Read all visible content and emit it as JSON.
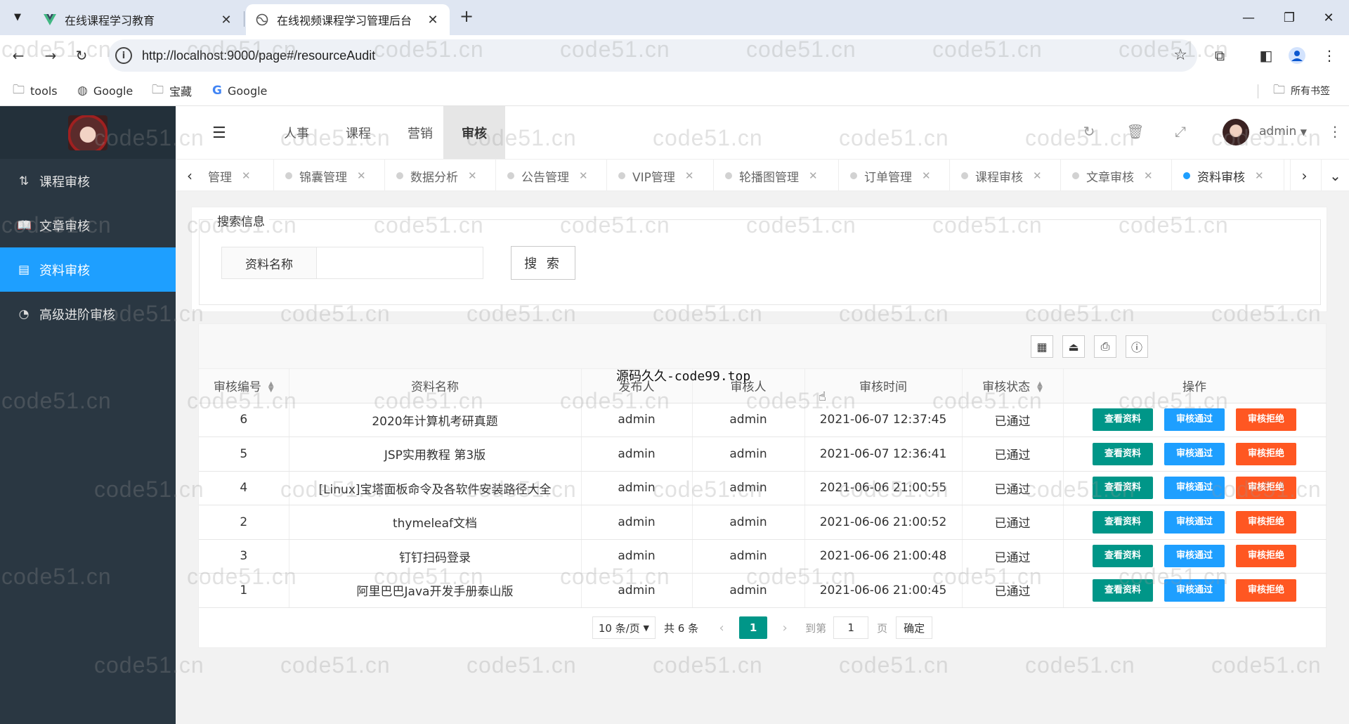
{
  "browser": {
    "tabs": [
      {
        "title": "在线课程学习教育",
        "active": false
      },
      {
        "title": "在线视频课程学习管理后台",
        "active": true
      }
    ],
    "url": "http://localhost:9000/page#/resourceAudit",
    "bookmarks": [
      "tools",
      "Google",
      "宝藏",
      "Google"
    ],
    "all_bookmarks": "所有书签"
  },
  "sidebar": {
    "items": [
      {
        "label": "课程审核",
        "icon": "sort-list-icon",
        "active": false
      },
      {
        "label": "文章审核",
        "icon": "book-icon",
        "active": false
      },
      {
        "label": "资料审核",
        "icon": "document-icon",
        "active": true
      },
      {
        "label": "高级进阶审核",
        "icon": "pie-chart-icon",
        "active": false
      }
    ]
  },
  "header": {
    "nav": [
      "人事",
      "课程",
      "营销",
      "审核"
    ],
    "active_nav": "审核",
    "user": "admin"
  },
  "page_tabs": [
    {
      "label": "管理"
    },
    {
      "label": "锦囊管理"
    },
    {
      "label": "数据分析"
    },
    {
      "label": "公告管理"
    },
    {
      "label": "VIP管理"
    },
    {
      "label": "轮播图管理"
    },
    {
      "label": "订单管理"
    },
    {
      "label": "课程审核"
    },
    {
      "label": "文章审核"
    },
    {
      "label": "资料审核",
      "active": true
    }
  ],
  "search": {
    "legend": "搜索信息",
    "label": "资料名称",
    "value": "",
    "button": "搜 索"
  },
  "overlay_text": "源码久久-code99.top",
  "table": {
    "columns": [
      "审核编号",
      "资料名称",
      "发布人",
      "审核人",
      "审核时间",
      "审核状态",
      "操作"
    ],
    "rows": [
      {
        "id": "6",
        "name": "2020年计算机考研真题",
        "publisher": "admin",
        "auditor": "admin",
        "time": "2021-06-07 12:37:45",
        "status": "已通过"
      },
      {
        "id": "5",
        "name": "JSP实用教程 第3版",
        "publisher": "admin",
        "auditor": "admin",
        "time": "2021-06-07 12:36:41",
        "status": "已通过"
      },
      {
        "id": "4",
        "name": "[Linux]宝塔面板命令及各软件安装路径大全",
        "publisher": "admin",
        "auditor": "admin",
        "time": "2021-06-06 21:00:55",
        "status": "已通过"
      },
      {
        "id": "2",
        "name": "thymeleaf文档",
        "publisher": "admin",
        "auditor": "admin",
        "time": "2021-06-06 21:00:52",
        "status": "已通过"
      },
      {
        "id": "3",
        "name": "钉钉扫码登录",
        "publisher": "admin",
        "auditor": "admin",
        "time": "2021-06-06 21:00:48",
        "status": "已通过"
      },
      {
        "id": "1",
        "name": "阿里巴巴Java开发手册泰山版",
        "publisher": "admin",
        "auditor": "admin",
        "time": "2021-06-06 21:00:45",
        "status": "已通过"
      }
    ],
    "actions": [
      "查看资料",
      "审核通过",
      "审核拒绝"
    ]
  },
  "pager": {
    "per_page": "10 条/页",
    "total": "共 6 条",
    "current": "1",
    "goto_label": "到第",
    "goto_value": "1",
    "page_label": "页",
    "confirm": "确定"
  },
  "watermark": "code51.cn",
  "colors": {
    "sidebar_bg": "#2a3742",
    "sidebar_active": "#1e9fff",
    "btn_view": "#009688",
    "btn_pass": "#1e9fff",
    "btn_deny": "#ff5722",
    "status_ok": "#009933"
  }
}
